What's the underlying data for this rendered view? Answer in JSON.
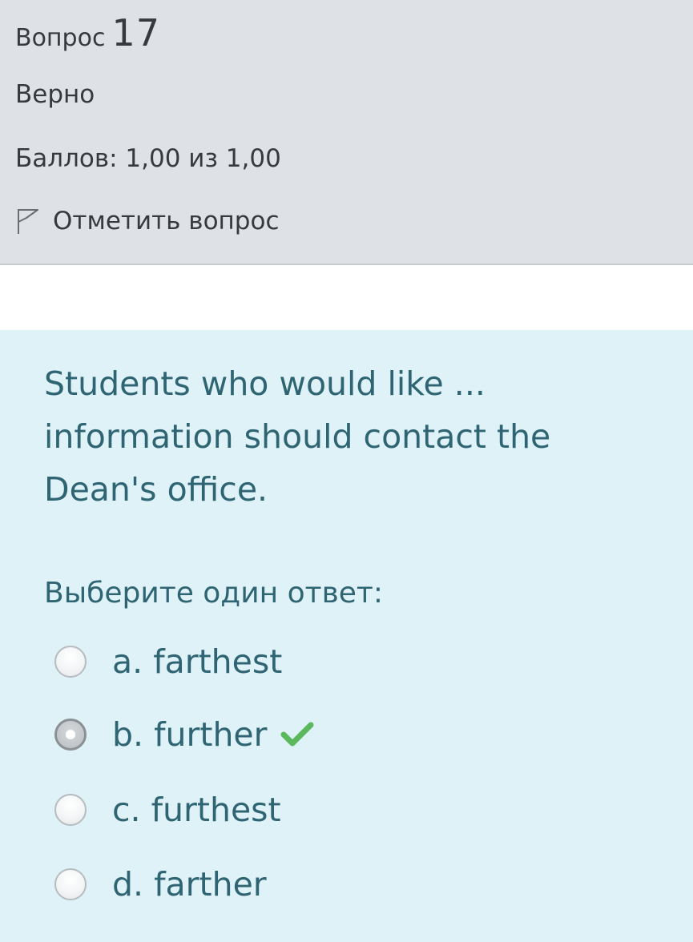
{
  "info": {
    "question_label": "Вопрос",
    "question_number": "17",
    "state": "Верно",
    "grade": "Баллов: 1,00 из 1,00",
    "flag_label": "Отметить вопрос",
    "flag_icon": "flag-outline-icon"
  },
  "question": {
    "text": "Students who would like ... information should contact the Dean's office.",
    "prompt": "Выберите один ответ:",
    "answers": [
      {
        "label": "a. farthest",
        "selected": false
      },
      {
        "label": "b. further",
        "selected": true,
        "correct": true
      },
      {
        "label": "c. furthest",
        "selected": false
      },
      {
        "label": "d. farther",
        "selected": false
      }
    ],
    "correct_icon": "checkmark-icon"
  },
  "colors": {
    "info_bg": "#dee2e6",
    "content_bg": "#def2f8",
    "content_text": "#2f6473",
    "correct_check": "#5cb85c"
  }
}
